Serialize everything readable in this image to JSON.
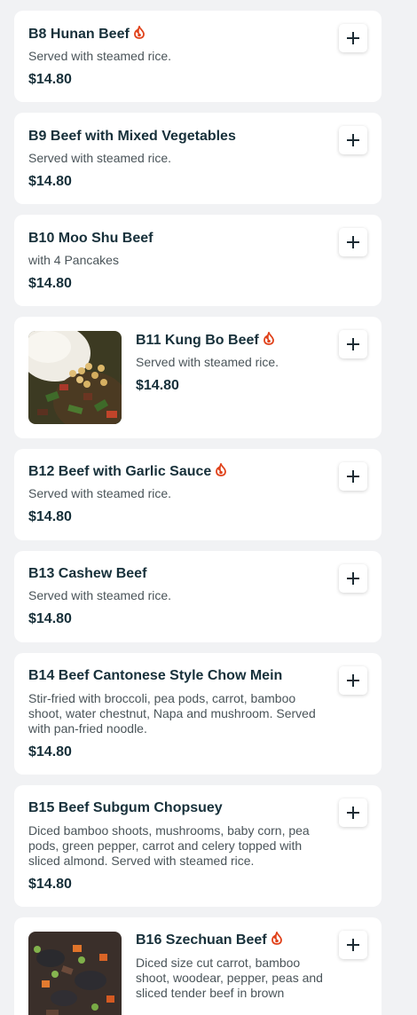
{
  "menu_items": [
    {
      "name": "B8 Hunan Beef",
      "spicy": true,
      "description": "Served with steamed rice.",
      "price": "$14.80"
    },
    {
      "name": "B9 Beef with Mixed Vegetables",
      "spicy": false,
      "description": "Served with steamed rice.",
      "price": "$14.80"
    },
    {
      "name": "B10 Moo Shu Beef",
      "spicy": false,
      "description": "with 4 Pancakes",
      "price": "$14.80"
    },
    {
      "name": "B11 Kung Bo Beef",
      "spicy": true,
      "description": "Served with steamed rice.",
      "price": "$14.80",
      "has_image": true
    },
    {
      "name": "B12 Beef with Garlic Sauce",
      "spicy": true,
      "description": "Served with steamed rice.",
      "price": "$14.80"
    },
    {
      "name": "B13 Cashew Beef",
      "spicy": false,
      "description": "Served with steamed rice.",
      "price": "$14.80"
    },
    {
      "name": "B14 Beef Cantonese Style Chow Mein",
      "spicy": false,
      "description": "Stir-fried with broccoli, pea pods, carrot, bamboo shoot, water chestnut, Napa and mushroom. Served with pan-fried noodle.",
      "price": "$14.80"
    },
    {
      "name": "B15 Beef Subgum Chopsuey",
      "spicy": false,
      "description": "Diced bamboo shoots, mushrooms, baby corn, pea pods, green pepper, carrot and celery topped with sliced almond. Served with steamed rice.",
      "price": "$14.80"
    },
    {
      "name": "B16 Szechuan Beef",
      "spicy": true,
      "description": "Diced size cut carrot, bamboo shoot, woodear, pepper, peas and sliced tender beef in brown",
      "price": "",
      "has_image": true
    }
  ],
  "icons": {
    "add": "plus-icon",
    "spicy": "flame-icon"
  },
  "colors": {
    "spicy": "#e0421b",
    "text": "#17303a"
  }
}
